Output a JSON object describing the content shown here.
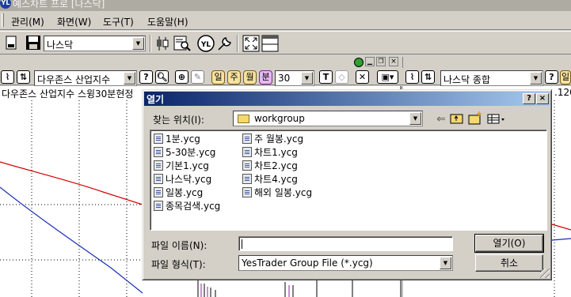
{
  "window": {
    "title": "예스차트 프로 [나스닥]",
    "logo_text": "YL"
  },
  "menu": {
    "items": [
      "관리(M)",
      "화면(W)",
      "도구(T)",
      "도움말(H)"
    ]
  },
  "toolbar1": {
    "symbol_value": "나스닥",
    "logo_text": "YL"
  },
  "left_panel": {
    "symbol_value": "다우존스 산업지수",
    "period_buttons": [
      "일",
      "주",
      "월",
      "분"
    ],
    "period_value": "30",
    "chart_title": "다우존스 산업지수 스윙30분현정"
  },
  "right_panel": {
    "symbol_value": "나스닥 종합",
    "period_button": "일",
    "price_fragment": ".120"
  },
  "dialog": {
    "title": "열기",
    "help_btn": "?",
    "close_btn": "×",
    "look_in_label": "찾는 위치(I):",
    "look_in_value": "workgroup",
    "files_col1": [
      "1분.ycg",
      "5-30분.ycg",
      "기본1.ycg",
      "나스닥.ycg",
      "일봉.ycg",
      "종목검색.ycg"
    ],
    "files_col2": [
      "주 월봉.ycg",
      "차트1.ycg",
      "차트2.ycg",
      "차트4.ycg",
      "해외 일봉.ycg"
    ],
    "filename_label": "파일 이름(N):",
    "filename_value": "",
    "filetype_label": "파일 형식(T):",
    "filetype_value": "YesTrader Group File (*.ycg)",
    "open_button": "열기(O)",
    "cancel_button": "취소"
  },
  "colors": {
    "accent_red": "#d40000",
    "accent_blue": "#1a2fb0",
    "dialog_title": "#0a246a"
  }
}
